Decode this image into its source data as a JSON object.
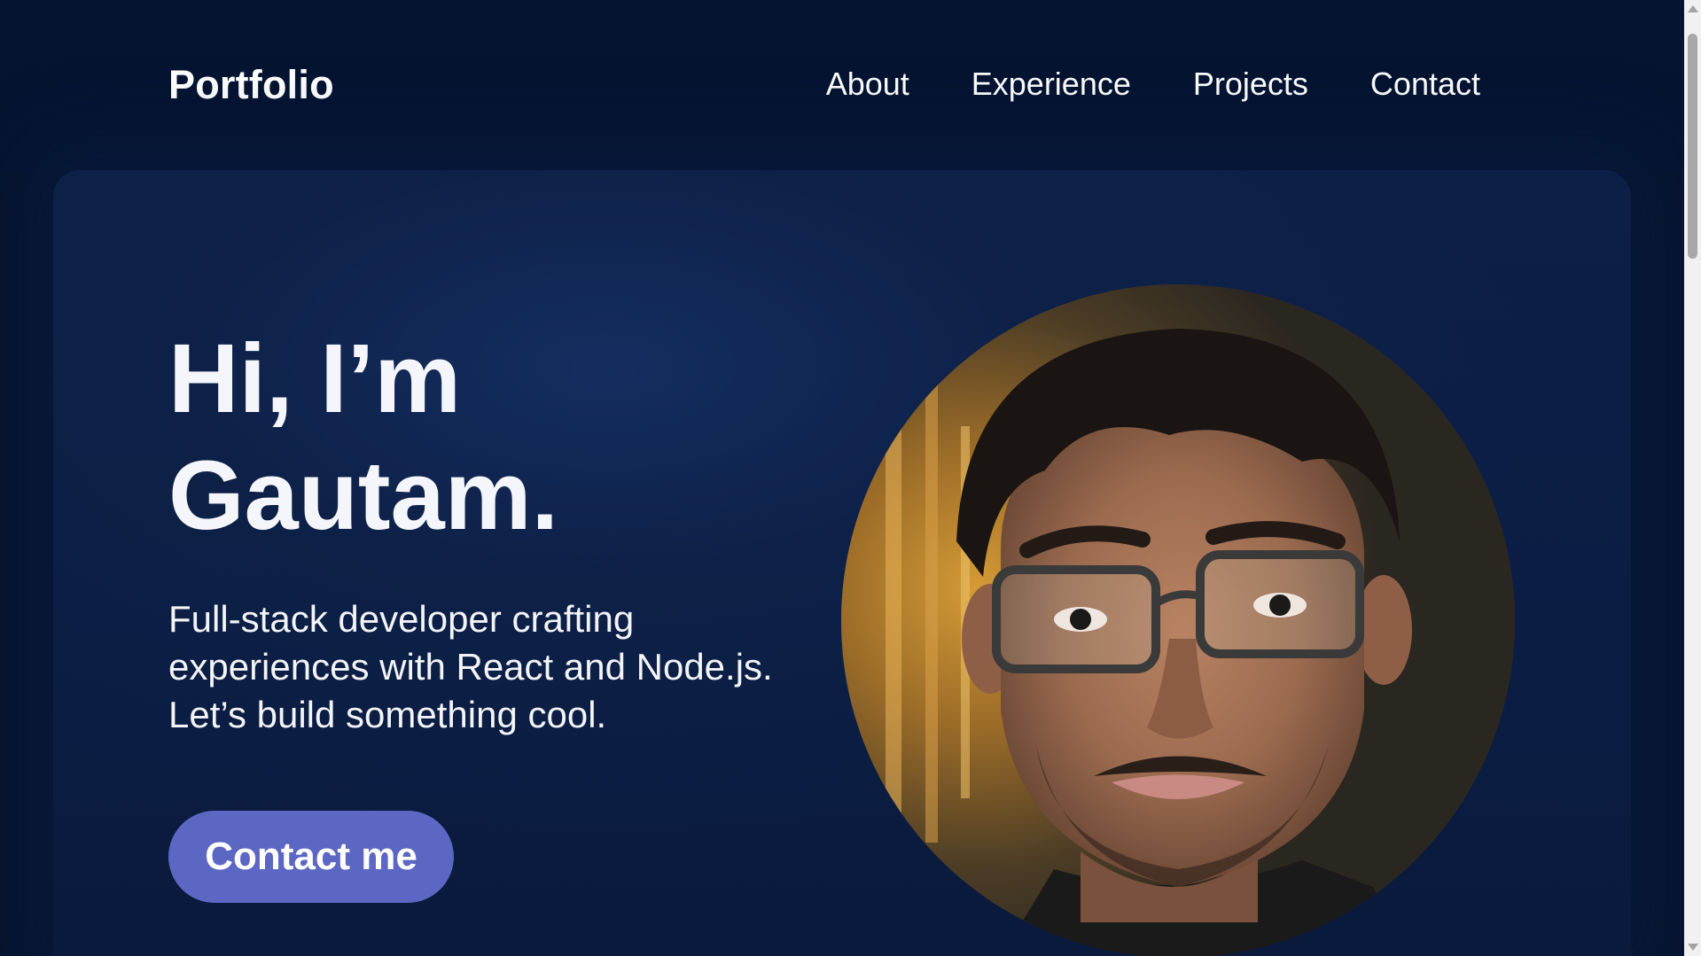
{
  "header": {
    "logo": "Portfolio",
    "nav": [
      "About",
      "Experience",
      "Projects",
      "Contact"
    ]
  },
  "hero": {
    "title_line1": "Hi, I’m",
    "title_line2": "Gautam.",
    "subtitle": "Full-stack developer crafting experiences with React and Node.js. Let’s build something cool.",
    "cta_label": "Contact me"
  },
  "colors": {
    "background": "#06142e",
    "hero_background": "#0c1f47",
    "accent": "#5b67c2",
    "text": "#ffffff"
  },
  "icons": {
    "avatar": "profile-photo"
  }
}
